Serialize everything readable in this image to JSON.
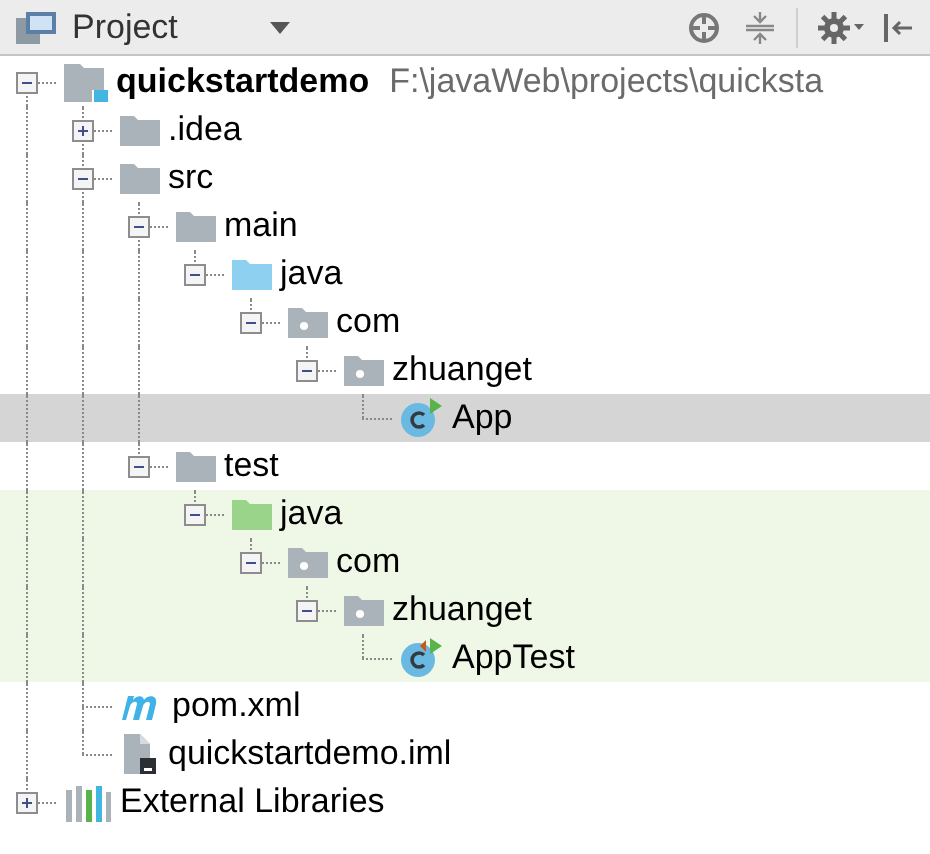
{
  "panel": {
    "title": "Project"
  },
  "tree": [
    {
      "kind": "module",
      "label": "quickstartdemo",
      "path": "F:\\javaWeb\\projects\\quicksta",
      "expanded": true,
      "selected": false,
      "test_scope": false,
      "children": [
        {
          "kind": "folder",
          "label": ".idea",
          "expanded": false,
          "selected": false,
          "test_scope": false
        },
        {
          "kind": "folder",
          "label": "src",
          "expanded": true,
          "selected": false,
          "test_scope": false,
          "children": [
            {
              "kind": "folder",
              "label": "main",
              "expanded": true,
              "selected": false,
              "test_scope": false,
              "children": [
                {
                  "kind": "source_folder",
                  "label": "java",
                  "expanded": true,
                  "selected": false,
                  "test_scope": false,
                  "children": [
                    {
                      "kind": "package",
                      "label": "com",
                      "expanded": true,
                      "selected": false,
                      "test_scope": false,
                      "children": [
                        {
                          "kind": "package",
                          "label": "zhuanget",
                          "expanded": true,
                          "selected": false,
                          "test_scope": false,
                          "children": [
                            {
                              "kind": "class",
                              "label": "App",
                              "selected": true,
                              "test_scope": false
                            }
                          ]
                        }
                      ]
                    }
                  ]
                }
              ]
            },
            {
              "kind": "folder",
              "label": "test",
              "expanded": true,
              "selected": false,
              "test_scope": false,
              "children": [
                {
                  "kind": "test_folder",
                  "label": "java",
                  "expanded": true,
                  "selected": false,
                  "test_scope": true,
                  "children": [
                    {
                      "kind": "package",
                      "label": "com",
                      "expanded": true,
                      "selected": false,
                      "test_scope": true,
                      "children": [
                        {
                          "kind": "package",
                          "label": "zhuanget",
                          "expanded": true,
                          "selected": false,
                          "test_scope": true,
                          "children": [
                            {
                              "kind": "test_class",
                              "label": "AppTest",
                              "selected": false,
                              "test_scope": true
                            }
                          ]
                        }
                      ]
                    }
                  ]
                }
              ]
            }
          ]
        },
        {
          "kind": "maven",
          "label": "pom.xml",
          "selected": false,
          "test_scope": false
        },
        {
          "kind": "iml",
          "label": "quickstartdemo.iml",
          "selected": false,
          "test_scope": false
        }
      ]
    },
    {
      "kind": "libraries",
      "label": "External Libraries",
      "expanded": false,
      "selected": false,
      "test_scope": false
    }
  ]
}
